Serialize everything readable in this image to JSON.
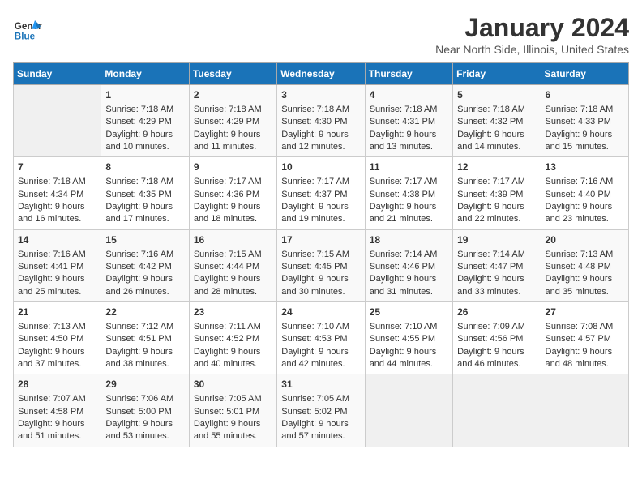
{
  "header": {
    "logo_line1": "General",
    "logo_line2": "Blue",
    "month": "January 2024",
    "location": "Near North Side, Illinois, United States"
  },
  "weekdays": [
    "Sunday",
    "Monday",
    "Tuesday",
    "Wednesday",
    "Thursday",
    "Friday",
    "Saturday"
  ],
  "weeks": [
    [
      {
        "day": "",
        "sunrise": "",
        "sunset": "",
        "daylight": ""
      },
      {
        "day": "1",
        "sunrise": "Sunrise: 7:18 AM",
        "sunset": "Sunset: 4:29 PM",
        "daylight": "Daylight: 9 hours and 10 minutes."
      },
      {
        "day": "2",
        "sunrise": "Sunrise: 7:18 AM",
        "sunset": "Sunset: 4:29 PM",
        "daylight": "Daylight: 9 hours and 11 minutes."
      },
      {
        "day": "3",
        "sunrise": "Sunrise: 7:18 AM",
        "sunset": "Sunset: 4:30 PM",
        "daylight": "Daylight: 9 hours and 12 minutes."
      },
      {
        "day": "4",
        "sunrise": "Sunrise: 7:18 AM",
        "sunset": "Sunset: 4:31 PM",
        "daylight": "Daylight: 9 hours and 13 minutes."
      },
      {
        "day": "5",
        "sunrise": "Sunrise: 7:18 AM",
        "sunset": "Sunset: 4:32 PM",
        "daylight": "Daylight: 9 hours and 14 minutes."
      },
      {
        "day": "6",
        "sunrise": "Sunrise: 7:18 AM",
        "sunset": "Sunset: 4:33 PM",
        "daylight": "Daylight: 9 hours and 15 minutes."
      }
    ],
    [
      {
        "day": "7",
        "sunrise": "Sunrise: 7:18 AM",
        "sunset": "Sunset: 4:34 PM",
        "daylight": "Daylight: 9 hours and 16 minutes."
      },
      {
        "day": "8",
        "sunrise": "Sunrise: 7:18 AM",
        "sunset": "Sunset: 4:35 PM",
        "daylight": "Daylight: 9 hours and 17 minutes."
      },
      {
        "day": "9",
        "sunrise": "Sunrise: 7:17 AM",
        "sunset": "Sunset: 4:36 PM",
        "daylight": "Daylight: 9 hours and 18 minutes."
      },
      {
        "day": "10",
        "sunrise": "Sunrise: 7:17 AM",
        "sunset": "Sunset: 4:37 PM",
        "daylight": "Daylight: 9 hours and 19 minutes."
      },
      {
        "day": "11",
        "sunrise": "Sunrise: 7:17 AM",
        "sunset": "Sunset: 4:38 PM",
        "daylight": "Daylight: 9 hours and 21 minutes."
      },
      {
        "day": "12",
        "sunrise": "Sunrise: 7:17 AM",
        "sunset": "Sunset: 4:39 PM",
        "daylight": "Daylight: 9 hours and 22 minutes."
      },
      {
        "day": "13",
        "sunrise": "Sunrise: 7:16 AM",
        "sunset": "Sunset: 4:40 PM",
        "daylight": "Daylight: 9 hours and 23 minutes."
      }
    ],
    [
      {
        "day": "14",
        "sunrise": "Sunrise: 7:16 AM",
        "sunset": "Sunset: 4:41 PM",
        "daylight": "Daylight: 9 hours and 25 minutes."
      },
      {
        "day": "15",
        "sunrise": "Sunrise: 7:16 AM",
        "sunset": "Sunset: 4:42 PM",
        "daylight": "Daylight: 9 hours and 26 minutes."
      },
      {
        "day": "16",
        "sunrise": "Sunrise: 7:15 AM",
        "sunset": "Sunset: 4:44 PM",
        "daylight": "Daylight: 9 hours and 28 minutes."
      },
      {
        "day": "17",
        "sunrise": "Sunrise: 7:15 AM",
        "sunset": "Sunset: 4:45 PM",
        "daylight": "Daylight: 9 hours and 30 minutes."
      },
      {
        "day": "18",
        "sunrise": "Sunrise: 7:14 AM",
        "sunset": "Sunset: 4:46 PM",
        "daylight": "Daylight: 9 hours and 31 minutes."
      },
      {
        "day": "19",
        "sunrise": "Sunrise: 7:14 AM",
        "sunset": "Sunset: 4:47 PM",
        "daylight": "Daylight: 9 hours and 33 minutes."
      },
      {
        "day": "20",
        "sunrise": "Sunrise: 7:13 AM",
        "sunset": "Sunset: 4:48 PM",
        "daylight": "Daylight: 9 hours and 35 minutes."
      }
    ],
    [
      {
        "day": "21",
        "sunrise": "Sunrise: 7:13 AM",
        "sunset": "Sunset: 4:50 PM",
        "daylight": "Daylight: 9 hours and 37 minutes."
      },
      {
        "day": "22",
        "sunrise": "Sunrise: 7:12 AM",
        "sunset": "Sunset: 4:51 PM",
        "daylight": "Daylight: 9 hours and 38 minutes."
      },
      {
        "day": "23",
        "sunrise": "Sunrise: 7:11 AM",
        "sunset": "Sunset: 4:52 PM",
        "daylight": "Daylight: 9 hours and 40 minutes."
      },
      {
        "day": "24",
        "sunrise": "Sunrise: 7:10 AM",
        "sunset": "Sunset: 4:53 PM",
        "daylight": "Daylight: 9 hours and 42 minutes."
      },
      {
        "day": "25",
        "sunrise": "Sunrise: 7:10 AM",
        "sunset": "Sunset: 4:55 PM",
        "daylight": "Daylight: 9 hours and 44 minutes."
      },
      {
        "day": "26",
        "sunrise": "Sunrise: 7:09 AM",
        "sunset": "Sunset: 4:56 PM",
        "daylight": "Daylight: 9 hours and 46 minutes."
      },
      {
        "day": "27",
        "sunrise": "Sunrise: 7:08 AM",
        "sunset": "Sunset: 4:57 PM",
        "daylight": "Daylight: 9 hours and 48 minutes."
      }
    ],
    [
      {
        "day": "28",
        "sunrise": "Sunrise: 7:07 AM",
        "sunset": "Sunset: 4:58 PM",
        "daylight": "Daylight: 9 hours and 51 minutes."
      },
      {
        "day": "29",
        "sunrise": "Sunrise: 7:06 AM",
        "sunset": "Sunset: 5:00 PM",
        "daylight": "Daylight: 9 hours and 53 minutes."
      },
      {
        "day": "30",
        "sunrise": "Sunrise: 7:05 AM",
        "sunset": "Sunset: 5:01 PM",
        "daylight": "Daylight: 9 hours and 55 minutes."
      },
      {
        "day": "31",
        "sunrise": "Sunrise: 7:05 AM",
        "sunset": "Sunset: 5:02 PM",
        "daylight": "Daylight: 9 hours and 57 minutes."
      },
      {
        "day": "",
        "sunrise": "",
        "sunset": "",
        "daylight": ""
      },
      {
        "day": "",
        "sunrise": "",
        "sunset": "",
        "daylight": ""
      },
      {
        "day": "",
        "sunrise": "",
        "sunset": "",
        "daylight": ""
      }
    ]
  ]
}
